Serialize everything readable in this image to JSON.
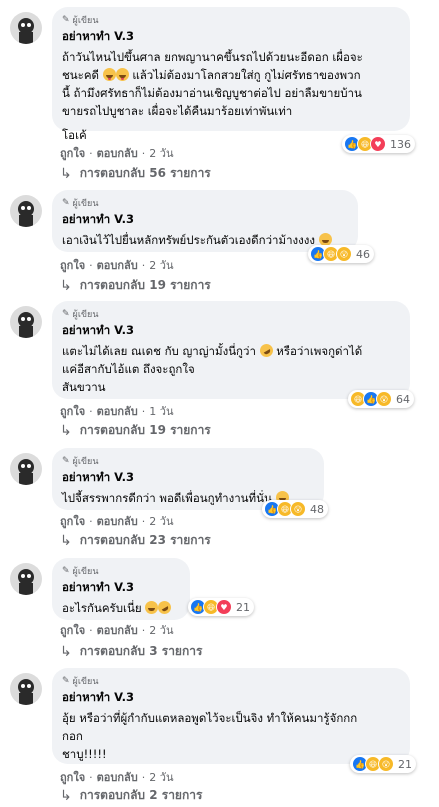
{
  "colors": {
    "bubble": "#f0f2f5",
    "muted": "#65676b",
    "text": "#050505",
    "like": "#1877f2",
    "haha": "#f7b928",
    "love": "#f33e58"
  },
  "labels": {
    "author_badge": "ผู้เขียน",
    "like": "ถูกใจ",
    "reply": "ตอบกลับ",
    "dot": "·"
  },
  "comments": [
    {
      "author": "อย่าหาทำ V.3",
      "lines": [
        "ถ้าวันไหนไปขึ้นศาล ยกพญานาคขึ้นรถไปด้วยนะอีดอก เผื่อจะ",
        "ชนะคดี",
        "แล้วไม่ต้องมาโลกสวยใส่กู กูไม่ศรัทธาของพวก",
        "นี้ ถ้ามึงศรัทธาก็ไม่ต้องมาอ่านเชิญบูชาต่อไป อย่าลืมขายบ้าน",
        "ขายรถไปบูชาละ เผื่อจะได้คืนมาร้อยเท่าพันเท่า",
        "โอเค้"
      ],
      "time": "2 วัน",
      "reactions": [
        "like",
        "haha",
        "love"
      ],
      "reaction_count": "136",
      "replies": "การตอบกลับ 56 รายการ"
    },
    {
      "author": "อย่าหาทำ V.3",
      "lines": [
        "เอาเงินไว้ไปยื่นหลักทรัพย์ประกันตัวเองดีกว่าม้างงงง"
      ],
      "time": "2 วัน",
      "reactions": [
        "like",
        "haha",
        "wow"
      ],
      "reaction_count": "46",
      "replies": "การตอบกลับ 19 รายการ"
    },
    {
      "author": "อย่าหาทำ V.3",
      "lines": [
        "แตะไม่ได้เลย ณเดช กับ ญาญ่ามั้งนี่กูว่า",
        "หรือว่าเพจกูด่าได้",
        "แค่อีสากับไอ้แต ถึงจะถูกใจ",
        "สันขวาน"
      ],
      "time": "1 วัน",
      "reactions": [
        "haha",
        "like",
        "wow"
      ],
      "reaction_count": "64",
      "replies": "การตอบกลับ 19 รายการ"
    },
    {
      "author": "อย่าหาทำ V.3",
      "lines": [
        "ไปจี้สรรพากรดีกว่า พอดีเพื่อนกูทำงานที่นั่น"
      ],
      "time": "2 วัน",
      "reactions": [
        "like",
        "haha",
        "wow"
      ],
      "reaction_count": "48",
      "replies": "การตอบกลับ 23 รายการ"
    },
    {
      "author": "อย่าหาทำ V.3",
      "lines": [
        "อะไรกันครับเนี่ย"
      ],
      "time": "2 วัน",
      "reactions": [
        "like",
        "haha",
        "love"
      ],
      "reaction_count": "21",
      "replies": "การตอบกลับ 3 รายการ"
    },
    {
      "author": "อย่าหาทำ V.3",
      "lines": [
        "อุ้ย หรือว่าที่ผู้กำกับแตหลอพูดไว้จะเป็นจิง ทำให้คนมารู้จักกก",
        "กอก",
        "ชาบู!!!!!"
      ],
      "time": "2 วัน",
      "reactions": [
        "like",
        "haha",
        "wow"
      ],
      "reaction_count": "21",
      "replies": "การตอบกลับ 2 รายการ"
    }
  ]
}
